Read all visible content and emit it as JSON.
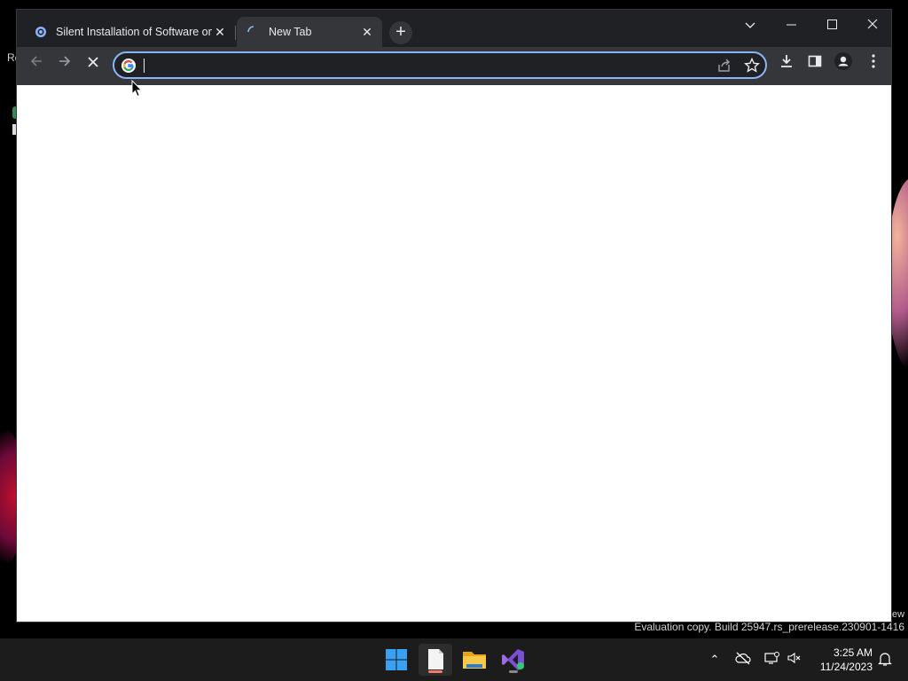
{
  "desktop": {
    "left_fragment_text": "Re",
    "watermark_fragment": "ew",
    "watermark": "Evaluation copy. Build 25947.rs_prerelease.230901-1416"
  },
  "browser": {
    "tabs": [
      {
        "title": "Silent Installation of Software on",
        "close_label": "✕",
        "favicon": "app-favicon-icon"
      },
      {
        "title": "New Tab",
        "close_label": "✕",
        "favicon": "loading-spinner-icon",
        "active": true
      }
    ],
    "new_tab_label": "+",
    "window_controls": {
      "tab_search": "⌄",
      "minimize": "–",
      "maximize": "☐",
      "close": "✕"
    },
    "toolbar": {
      "back_label": "←",
      "forward_label": "→",
      "stop_label": "✕",
      "omnibox": {
        "value": "",
        "placeholder": ""
      },
      "download_label": "⤓",
      "menu_label": "⋮"
    }
  },
  "taskbar": {
    "apps": [
      "start",
      "notepad",
      "file-explorer",
      "visual-studio"
    ],
    "tray": {
      "chevron": "⌃"
    },
    "clock": {
      "time": "3:25 AM",
      "date": "11/24/2023"
    }
  },
  "colors": {
    "titlebar": "#202124",
    "toolbar": "#35363a",
    "focus_ring": "#8ab4f8",
    "taskbar": "#1c1c1c"
  }
}
